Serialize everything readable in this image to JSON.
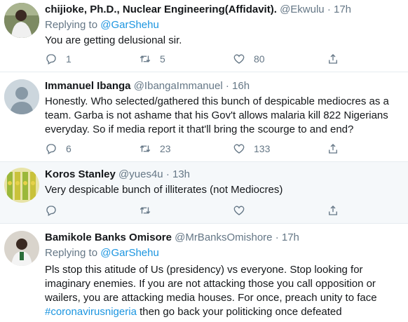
{
  "tweets": [
    {
      "name": "chijioke, Ph.D., Nuclear Engineering(Affidavit).",
      "handle": "@Ekwulu",
      "time": "17h",
      "replying_label": "Replying to",
      "replying_to": "@GarShehu",
      "text": "You are getting delusional sir.",
      "replies": "1",
      "retweets": "5",
      "likes": "80"
    },
    {
      "name": "Immanuel Ibanga",
      "handle": "@IbangaImmanuel",
      "time": "16h",
      "lines": [
        "Honestly. Who selected/gathered this bunch of despicable mediocres as a",
        "team. Garba is not ashame that his Gov't allows malaria kill 822 Nigerians",
        "everyday. So if media report it that'll bring the scourge to and end?"
      ],
      "replies": "6",
      "retweets": "23",
      "likes": "133"
    },
    {
      "name": "Koros Stanley",
      "handle": "@yues4u",
      "time": "13h",
      "text": "Very despicable bunch of illiterates (not Mediocres)"
    },
    {
      "name": "Bamikole Banks Omisore",
      "handle": "@MrBanksOmishore",
      "time": "17h",
      "replying_label": "Replying to",
      "replying_to": "@GarShehu",
      "lines": [
        "Pls stop this atitude of Us (presidency) vs everyone. Stop looking for",
        "imaginary enemies. If you are not attacking those you call opposition or",
        "wailers, you are attacking media houses. For once, preach unity to face"
      ],
      "hashtag": "#coronavirusnigeria",
      "last_line_rest": " then go back your politicking once defeated"
    }
  ],
  "separator": "·",
  "colors": {
    "accent": "#1b95e0",
    "muted": "#657786",
    "highlight_bg": "#f5f8fa"
  },
  "icons": [
    "reply-icon",
    "retweet-icon",
    "like-icon",
    "share-icon"
  ]
}
